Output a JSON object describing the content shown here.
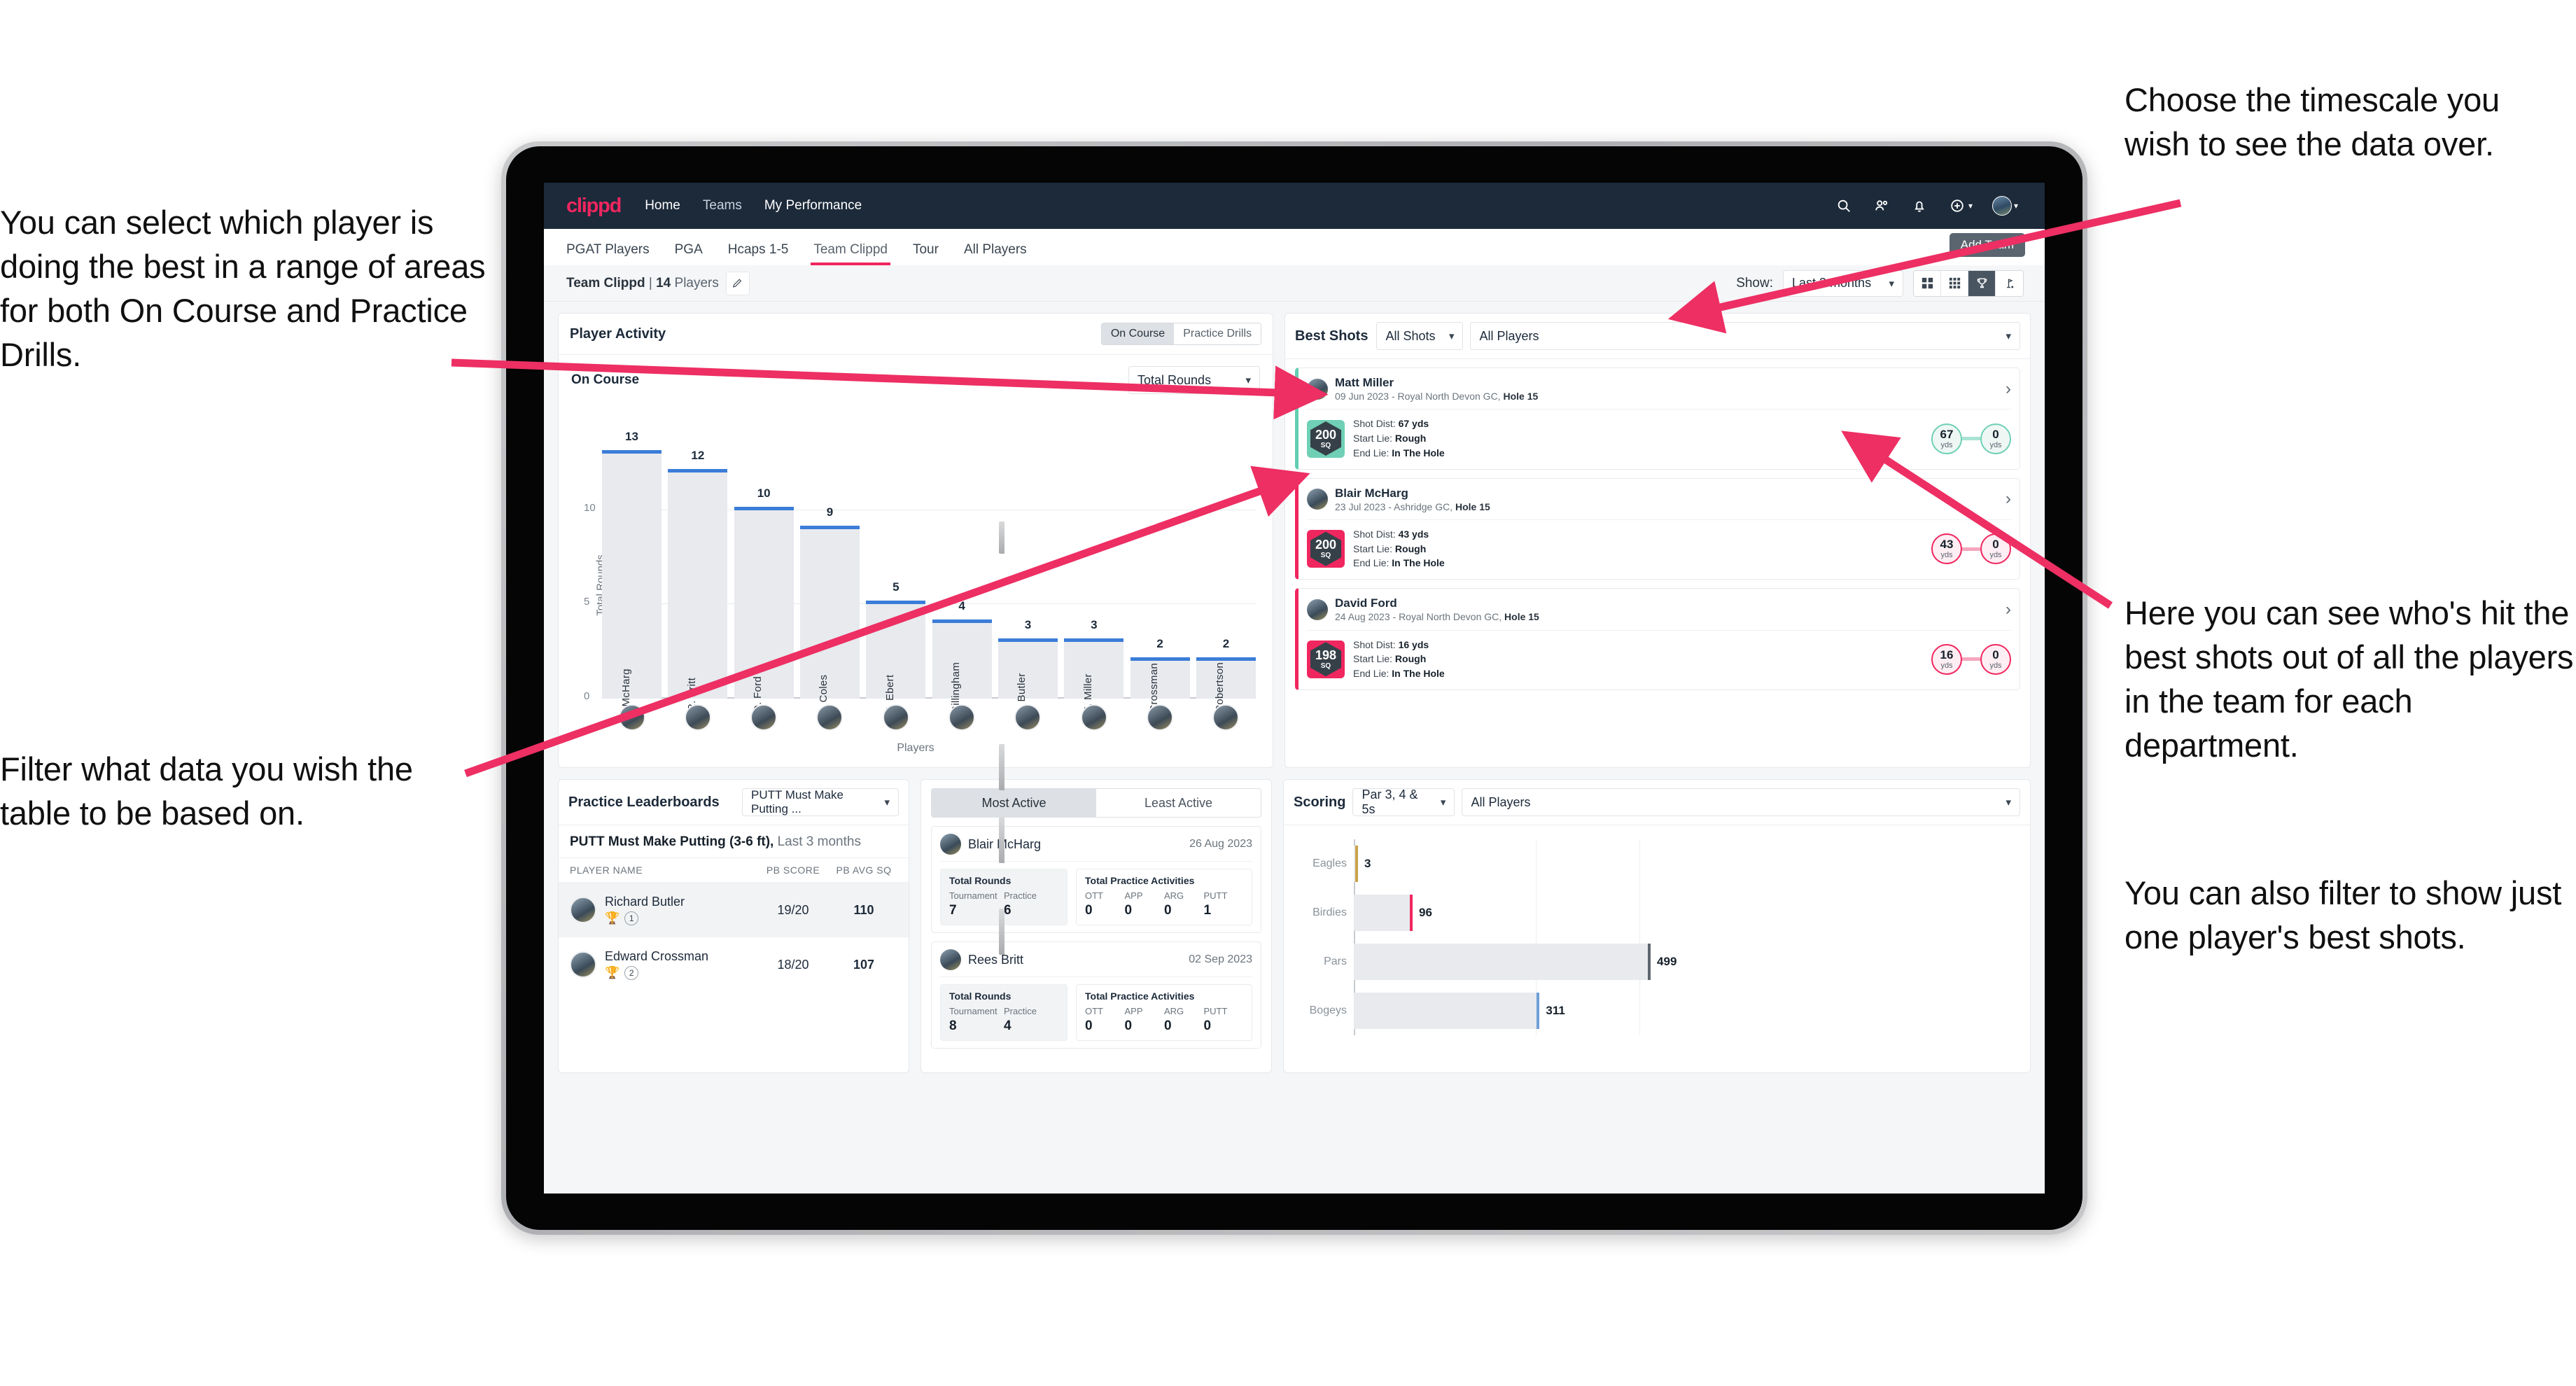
{
  "annotations": {
    "left_top": "You can select which player is doing the best in a range of areas for both On Course and Practice Drills.",
    "left_bottom": "Filter what data you wish the table to be based on.",
    "right_top": "Choose the timescale you wish to see the data over.",
    "right_middle": "Here you can see who's hit the best shots out of all the players in the team for each department.",
    "right_bottom": "You can also filter to show just one player's best shots."
  },
  "navbar": {
    "logo": "clippd",
    "links": [
      "Home",
      "Teams",
      "My Performance"
    ],
    "icons": [
      "search-icon",
      "people-icon",
      "bell-icon",
      "plus-circle-icon",
      "avatar"
    ]
  },
  "tabs": {
    "items": [
      "PGAT Players",
      "PGA",
      "Hcaps 1-5",
      "Team Clippd",
      "Tour",
      "All Players"
    ],
    "active": "Team Clippd",
    "tooltip": "Add Team"
  },
  "toolbar": {
    "team_name": "Team Clippd",
    "team_sep": " | ",
    "team_count": "14",
    "team_players_word": " Players",
    "edit_icon": "pencil-icon",
    "show_label": "Show:",
    "show_value": "Last 3 months",
    "view_icons": [
      "grid-large-icon",
      "grid-small-icon",
      "trophy-icon",
      "flag-icon"
    ],
    "view_active_index": 2
  },
  "player_activity": {
    "title": "Player Activity",
    "segments": [
      "On Course",
      "Practice Drills"
    ],
    "segment_active": "On Course",
    "sub_title": "On Course",
    "metric_select": "Total Rounds"
  },
  "best_shots": {
    "title": "Best Shots",
    "shot_filter": "All Shots",
    "player_filter": "All Players",
    "cards": [
      {
        "player": "Matt Miller",
        "meta_date": "09 Jun 2023 - Royal North Devon GC, ",
        "meta_hole": "Hole 15",
        "badge_value": "200",
        "badge_unit": "SQ",
        "accent": "teal",
        "shot_dist_label": "Shot Dist: ",
        "shot_dist_value": "67 yds",
        "start_lie_label": "Start Lie: ",
        "start_lie_value": "Rough",
        "end_lie_label": "End Lie: ",
        "end_lie_value": "In The Hole",
        "from_value": "67",
        "from_unit": "yds",
        "to_value": "0",
        "to_unit": "yds"
      },
      {
        "player": "Blair McHarg",
        "meta_date": "23 Jul 2023 - Ashridge GC, ",
        "meta_hole": "Hole 15",
        "badge_value": "200",
        "badge_unit": "SQ",
        "accent": "pink",
        "shot_dist_label": "Shot Dist: ",
        "shot_dist_value": "43 yds",
        "start_lie_label": "Start Lie: ",
        "start_lie_value": "Rough",
        "end_lie_label": "End Lie: ",
        "end_lie_value": "In The Hole",
        "from_value": "43",
        "from_unit": "yds",
        "to_value": "0",
        "to_unit": "yds"
      },
      {
        "player": "David Ford",
        "meta_date": "24 Aug 2023 - Royal North Devon GC, ",
        "meta_hole": "Hole 15",
        "badge_value": "198",
        "badge_unit": "SQ",
        "accent": "pink",
        "shot_dist_label": "Shot Dist: ",
        "shot_dist_value": "16 yds",
        "start_lie_label": "Start Lie: ",
        "start_lie_value": "Rough",
        "end_lie_label": "End Lie: ",
        "end_lie_value": "In The Hole",
        "from_value": "16",
        "from_unit": "yds",
        "to_value": "0",
        "to_unit": "yds"
      }
    ]
  },
  "practice_leaderboards": {
    "title": "Practice Leaderboards",
    "drill_select": "PUTT Must Make Putting ...",
    "subtitle_bold": "PUTT Must Make Putting (3-6 ft),",
    "subtitle_muted": " Last 3 months",
    "columns": [
      "PLAYER NAME",
      "PB SCORE",
      "PB AVG SQ"
    ],
    "rows": [
      {
        "name": "Richard Butler",
        "trophy": "gold",
        "rank": "1",
        "pb_score": "19/20",
        "pb_avg_sq": "110"
      },
      {
        "name": "Edward Crossman",
        "trophy": "silver",
        "rank": "2",
        "pb_score": "18/20",
        "pb_avg_sq": "107"
      }
    ]
  },
  "activity_leaderboard": {
    "tabs": [
      "Most Active",
      "Least Active"
    ],
    "active_tab": "Most Active",
    "cards": [
      {
        "name": "Blair McHarg",
        "date": "26 Aug 2023",
        "rounds_title": "Total Rounds",
        "rounds_cols": [
          "Tournament",
          "Practice"
        ],
        "rounds_vals": [
          "7",
          "6"
        ],
        "practice_title": "Total Practice Activities",
        "practice_cols": [
          "OTT",
          "APP",
          "ARG",
          "PUTT"
        ],
        "practice_vals": [
          "0",
          "0",
          "0",
          "1"
        ]
      },
      {
        "name": "Rees Britt",
        "date": "02 Sep 2023",
        "rounds_title": "Total Rounds",
        "rounds_cols": [
          "Tournament",
          "Practice"
        ],
        "rounds_vals": [
          "8",
          "4"
        ],
        "practice_title": "Total Practice Activities",
        "practice_cols": [
          "OTT",
          "APP",
          "ARG",
          "PUTT"
        ],
        "practice_vals": [
          "0",
          "0",
          "0",
          "0"
        ]
      }
    ]
  },
  "scoring": {
    "title": "Scoring",
    "par_filter": "Par 3, 4 & 5s",
    "player_filter": "All Players"
  },
  "colors": {
    "brand_pink": "#f0265f",
    "nav_dark": "#1c2a3a",
    "bar_cap_blue": "#3b7dd8",
    "teal": "#6fd0b5",
    "eagle_gold": "#c9a349",
    "bogey_blue": "#6f9fd8"
  },
  "chart_data": [
    {
      "type": "bar",
      "title": "Player Activity - On Course",
      "xlabel": "Players",
      "ylabel": "Total Rounds",
      "ylim": [
        0,
        14
      ],
      "yticks": [
        0,
        5,
        10
      ],
      "grid": true,
      "categories": [
        "B. McHarg",
        "R. Britt",
        "D. Ford",
        "J. Coles",
        "E. Ebert",
        "D. Billingham",
        "R. Butler",
        "M. Miller",
        "E. Crossman",
        "C. Robertson"
      ],
      "values": [
        13,
        12,
        10,
        9,
        5,
        4,
        3,
        3,
        2,
        2
      ]
    },
    {
      "type": "bar",
      "orientation": "horizontal",
      "title": "Scoring",
      "xlabel": "",
      "ylabel": "",
      "categories": [
        "Eagles",
        "Birdies",
        "Pars",
        "Bogeys"
      ],
      "values": [
        3,
        96,
        499,
        311
      ],
      "colors": [
        "#c9a349",
        "#f0265f",
        "#5d666f",
        "#6f9fd8"
      ],
      "xlim": [
        0,
        640
      ],
      "grid": true
    }
  ]
}
